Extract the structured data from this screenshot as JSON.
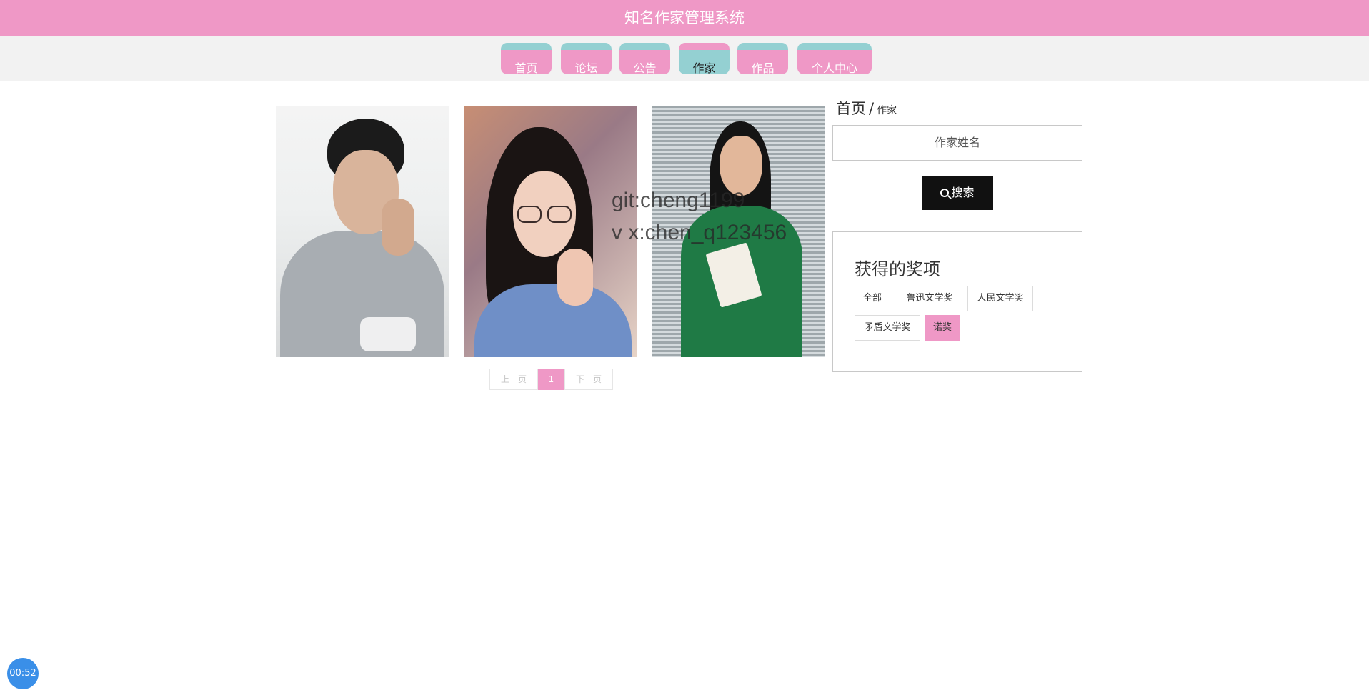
{
  "app": {
    "title": "知名作家管理系统"
  },
  "nav": {
    "items": [
      {
        "label": "首页"
      },
      {
        "label": "论坛"
      },
      {
        "label": "公告"
      },
      {
        "label": "作家",
        "active": true
      },
      {
        "label": "作品"
      },
      {
        "label": "个人中心"
      }
    ]
  },
  "writers": {
    "cards": [
      {
        "photo": "writer-photo-man-grey-shirt"
      },
      {
        "photo": "writer-photo-woman-glasses"
      },
      {
        "photo": "writer-photo-woman-green-dress"
      }
    ]
  },
  "watermark": {
    "line1": "git:cheng1199",
    "line2": "v x:chen_q123456"
  },
  "pager": {
    "prev": "上一页",
    "current": "1",
    "next": "下一页"
  },
  "breadcrumb": {
    "home": "首页",
    "separator": "/",
    "current": "作家"
  },
  "search": {
    "placeholder": "作家姓名",
    "button_label": "搜索"
  },
  "awards": {
    "title": "获得的奖项",
    "tags": [
      {
        "label": "全部"
      },
      {
        "label": "鲁迅文学奖"
      },
      {
        "label": "人民文学奖"
      },
      {
        "label": "矛盾文学奖"
      },
      {
        "label": "诺奖",
        "active": true
      }
    ]
  },
  "timer": {
    "text": "00:52"
  },
  "colors": {
    "primary_pink": "#ef98c6",
    "accent_teal": "#94d0d2",
    "button_dark": "#111111"
  }
}
